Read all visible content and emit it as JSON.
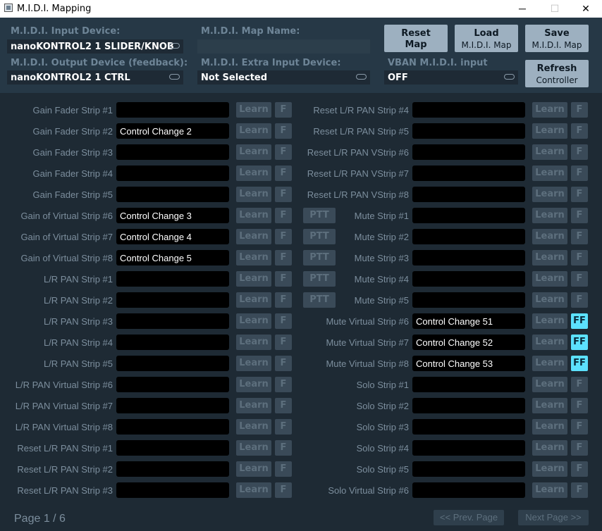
{
  "window": {
    "title": "M.I.D.I. Mapping",
    "minimize": "─",
    "maximize": "☐",
    "close": "✕"
  },
  "header": {
    "input_device_label": "M.I.D.I. Input Device:",
    "input_device_value": "nanoKONTROL2 1 SLIDER/KNOB",
    "output_device_label": "M.I.D.I. Output Device (feedback):",
    "output_device_value": "nanoKONTROL2 1 CTRL",
    "map_name_label": "M.I.D.I. Map Name:",
    "map_name_value": "",
    "extra_input_label": "M.I.D.I. Extra Input Device:",
    "extra_input_value": "Not Selected",
    "vban_label": "VBAN M.I.D.I. input",
    "vban_value": "OFF",
    "reset_l1": "Reset",
    "reset_l2": "Map",
    "load_l1": "Load",
    "load_l2": "M.I.D.I. Map",
    "save_l1": "Save",
    "save_l2": "M.I.D.I. Map",
    "refresh_l1": "Refresh",
    "refresh_l2": "Controller"
  },
  "buttons": {
    "learn": "Learn",
    "f": "F",
    "ff": "FF",
    "ptt": "PTT"
  },
  "left_rows": [
    {
      "label": "Gain Fader Strip #1",
      "value": "",
      "ptt": false
    },
    {
      "label": "Gain Fader Strip #2",
      "value": "Control Change 2",
      "ptt": false
    },
    {
      "label": "Gain Fader Strip #3",
      "value": "",
      "ptt": false
    },
    {
      "label": "Gain Fader Strip #4",
      "value": "",
      "ptt": false
    },
    {
      "label": "Gain Fader Strip #5",
      "value": "",
      "ptt": false
    },
    {
      "label": "Gain of Virtual Strip #6",
      "value": "Control Change 3",
      "ptt": true
    },
    {
      "label": "Gain of Virtual Strip #7",
      "value": "Control Change 4",
      "ptt": true
    },
    {
      "label": "Gain of Virtual Strip #8",
      "value": "Control Change 5",
      "ptt": true
    },
    {
      "label": "L/R PAN Strip #1",
      "value": "",
      "ptt": true
    },
    {
      "label": "L/R PAN Strip #2",
      "value": "",
      "ptt": true
    },
    {
      "label": "L/R PAN Strip #3",
      "value": "",
      "ptt": false
    },
    {
      "label": "L/R PAN Strip #4",
      "value": "",
      "ptt": false
    },
    {
      "label": "L/R PAN Strip #5",
      "value": "",
      "ptt": false
    },
    {
      "label": "L/R PAN Virtual Strip #6",
      "value": "",
      "ptt": false
    },
    {
      "label": "L/R PAN Virtual Strip #7",
      "value": "",
      "ptt": false
    },
    {
      "label": "L/R PAN Virtual Strip #8",
      "value": "",
      "ptt": false
    },
    {
      "label": "Reset L/R PAN Strip #1",
      "value": "",
      "ptt": false
    },
    {
      "label": "Reset L/R PAN Strip #2",
      "value": "",
      "ptt": false
    },
    {
      "label": "Reset L/R PAN Strip #3",
      "value": "",
      "ptt": false
    }
  ],
  "right_rows": [
    {
      "label": "Reset L/R PAN Strip #4",
      "value": "",
      "ff": false
    },
    {
      "label": "Reset L/R PAN Strip #5",
      "value": "",
      "ff": false
    },
    {
      "label": "Reset L/R PAN VStrip #6",
      "value": "",
      "ff": false
    },
    {
      "label": "Reset L/R PAN VStrip #7",
      "value": "",
      "ff": false
    },
    {
      "label": "Reset L/R PAN VStrip #8",
      "value": "",
      "ff": false
    },
    {
      "label": "Mute Strip #1",
      "value": "",
      "ff": false
    },
    {
      "label": "Mute Strip #2",
      "value": "",
      "ff": false
    },
    {
      "label": "Mute Strip #3",
      "value": "",
      "ff": false
    },
    {
      "label": "Mute Strip #4",
      "value": "",
      "ff": false
    },
    {
      "label": "Mute Strip #5",
      "value": "",
      "ff": false
    },
    {
      "label": "Mute Virtual Strip #6",
      "value": "Control Change 51",
      "ff": true
    },
    {
      "label": "Mute Virtual Strip #7",
      "value": "Control Change 52",
      "ff": true
    },
    {
      "label": "Mute Virtual Strip #8",
      "value": "Control Change 53",
      "ff": true
    },
    {
      "label": "Solo Strip #1",
      "value": "",
      "ff": false
    },
    {
      "label": "Solo Strip #2",
      "value": "",
      "ff": false
    },
    {
      "label": "Solo Strip #3",
      "value": "",
      "ff": false
    },
    {
      "label": "Solo Strip #4",
      "value": "",
      "ff": false
    },
    {
      "label": "Solo Strip #5",
      "value": "",
      "ff": false
    },
    {
      "label": "Solo Virtual Strip #6",
      "value": "",
      "ff": false
    }
  ],
  "footer": {
    "page_label": "Page 1 / 6",
    "prev": "<< Prev. Page",
    "next": "Next Page >>"
  },
  "colors": {
    "background": "#1e2a34",
    "header": "#263846",
    "ff_active": "#5ce1ff",
    "button": "#9db0c0"
  }
}
